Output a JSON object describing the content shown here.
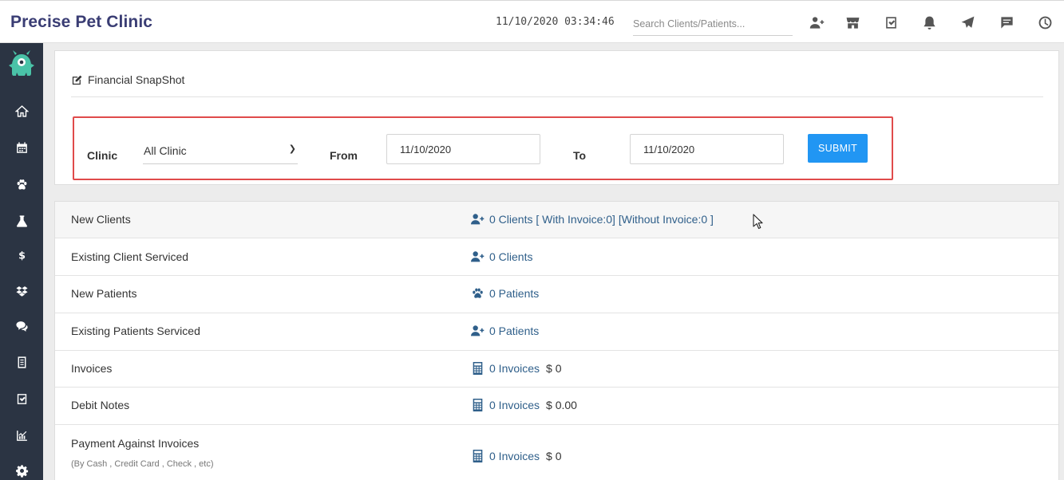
{
  "app": {
    "brand": "Precise Pet Clinic",
    "datetime": "11/10/2020 03:34:46"
  },
  "search": {
    "placeholder": "Search Clients/Patients..."
  },
  "panel": {
    "title": "Financial SnapShot"
  },
  "filter": {
    "clinic_label": "Clinic",
    "clinic_value": "All Clinic",
    "from_label": "From",
    "from_value": "11/10/2020",
    "to_label": "To",
    "to_value": "11/10/2020",
    "submit_label": "SUBMIT"
  },
  "stats": [
    {
      "label": "New Clients",
      "icon": "user-plus-icon",
      "value": "0 Clients [ With Invoice:0]  [Without Invoice:0 ]",
      "amount": ""
    },
    {
      "label": "Existing Client Serviced",
      "icon": "user-plus-icon",
      "value": "0 Clients",
      "amount": ""
    },
    {
      "label": "New Patients",
      "icon": "paw-icon",
      "value": "0 Patients",
      "amount": ""
    },
    {
      "label": "Existing Patients Serviced",
      "icon": "user-plus-icon",
      "value": "0 Patients",
      "amount": ""
    },
    {
      "label": "Invoices",
      "icon": "calculator-icon",
      "value": "0 Invoices",
      "amount": "$ 0"
    },
    {
      "label": "Debit Notes",
      "icon": "calculator-icon",
      "value": "0 Invoices",
      "amount": "$ 0.00"
    },
    {
      "label": "Payment Against Invoices",
      "sublabel": "(By Cash , Credit Card , Check , etc)",
      "icon": "calculator-icon",
      "value": "0 Invoices",
      "amount": "$ 0"
    }
  ],
  "colors": {
    "brand": "#3a3d74",
    "sidebar": "#2b3443",
    "accent": "#2196f3",
    "highlight_border": "#e04b4b",
    "link": "#2f5f8a"
  },
  "icons": {
    "topbar": [
      "user-plus-icon",
      "store-icon",
      "checkbox-icon",
      "bell-icon",
      "send-icon",
      "chat-icon",
      "clock-icon"
    ],
    "sidebar": [
      "home-icon",
      "calendar-icon",
      "paw-icon",
      "flask-icon",
      "dollar-icon",
      "dropbox-icon",
      "comments-icon",
      "list-icon",
      "checkbox-icon",
      "chart-icon",
      "gear-icon"
    ]
  }
}
